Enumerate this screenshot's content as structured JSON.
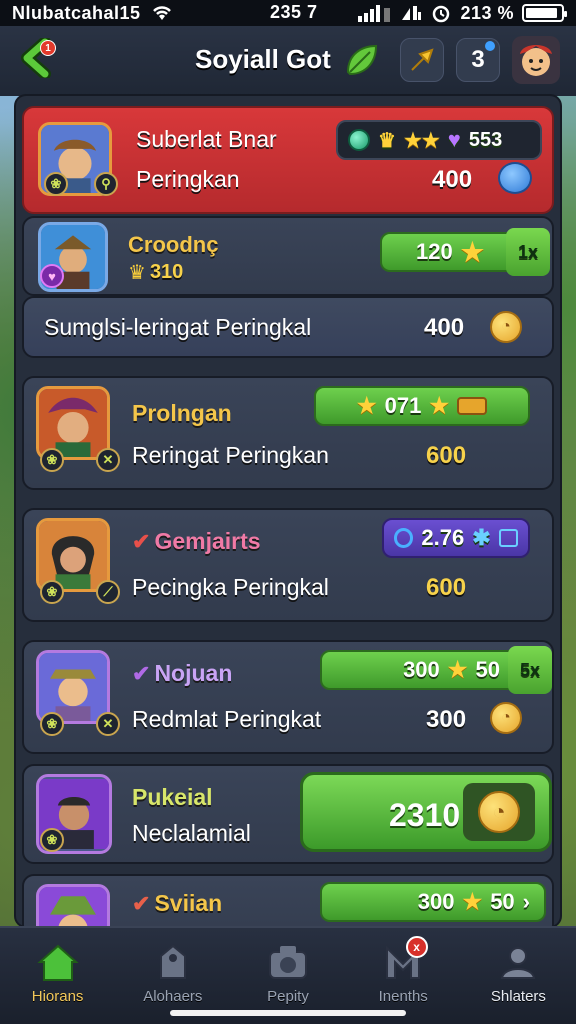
{
  "status_bar": {
    "carrier": "Nlubatcahal15",
    "time": "235 7",
    "battery_percent": "213 %",
    "battery_level": 0.9
  },
  "header": {
    "title": "Soyiall Got",
    "back_badge": "1",
    "count": "3"
  },
  "rows": [
    {
      "name": "Suberlat Bnar",
      "subtitle": "Peringkan",
      "score": "400",
      "stat": "553"
    },
    {
      "name": "Croodnç",
      "subtitle": "310",
      "pill_value": "120",
      "pill_tab": "1x"
    },
    {
      "subtitle": "Sumglsi-leringat Peringkal",
      "score": "400"
    },
    {
      "name": "Prolngan",
      "subtitle": "Reringat Peringkan",
      "score": "600",
      "pill_value": "071"
    },
    {
      "name": "Gemjairts",
      "subtitle": "Pecingka Peringkal",
      "score": "600",
      "pill_value": "2.76"
    },
    {
      "name": "Nojuan",
      "subtitle": "Redmlat Peringkat",
      "score": "300",
      "pill_value": "300",
      "pill_value_b": "50",
      "pill_tab": "5x"
    },
    {
      "name": "Pukeial",
      "subtitle": "Neclalamial",
      "button_value": "2310"
    },
    {
      "name": "Sviian",
      "pill_value": "300",
      "pill_value_b": "50"
    }
  ],
  "nav": [
    {
      "label": "Hiorans",
      "icon": "home-icon",
      "active": true
    },
    {
      "label": "Alohaers",
      "icon": "tag-icon"
    },
    {
      "label": "Pepity",
      "icon": "camera-icon"
    },
    {
      "label": "Inenths",
      "icon": "m-icon",
      "badge": "x"
    },
    {
      "label": "Shlaters",
      "icon": "profile-icon"
    }
  ],
  "colors": {
    "highlight_row": "#d8383a",
    "accent_gold": "#f4c64a",
    "accent_green": "#5cbf3e"
  }
}
